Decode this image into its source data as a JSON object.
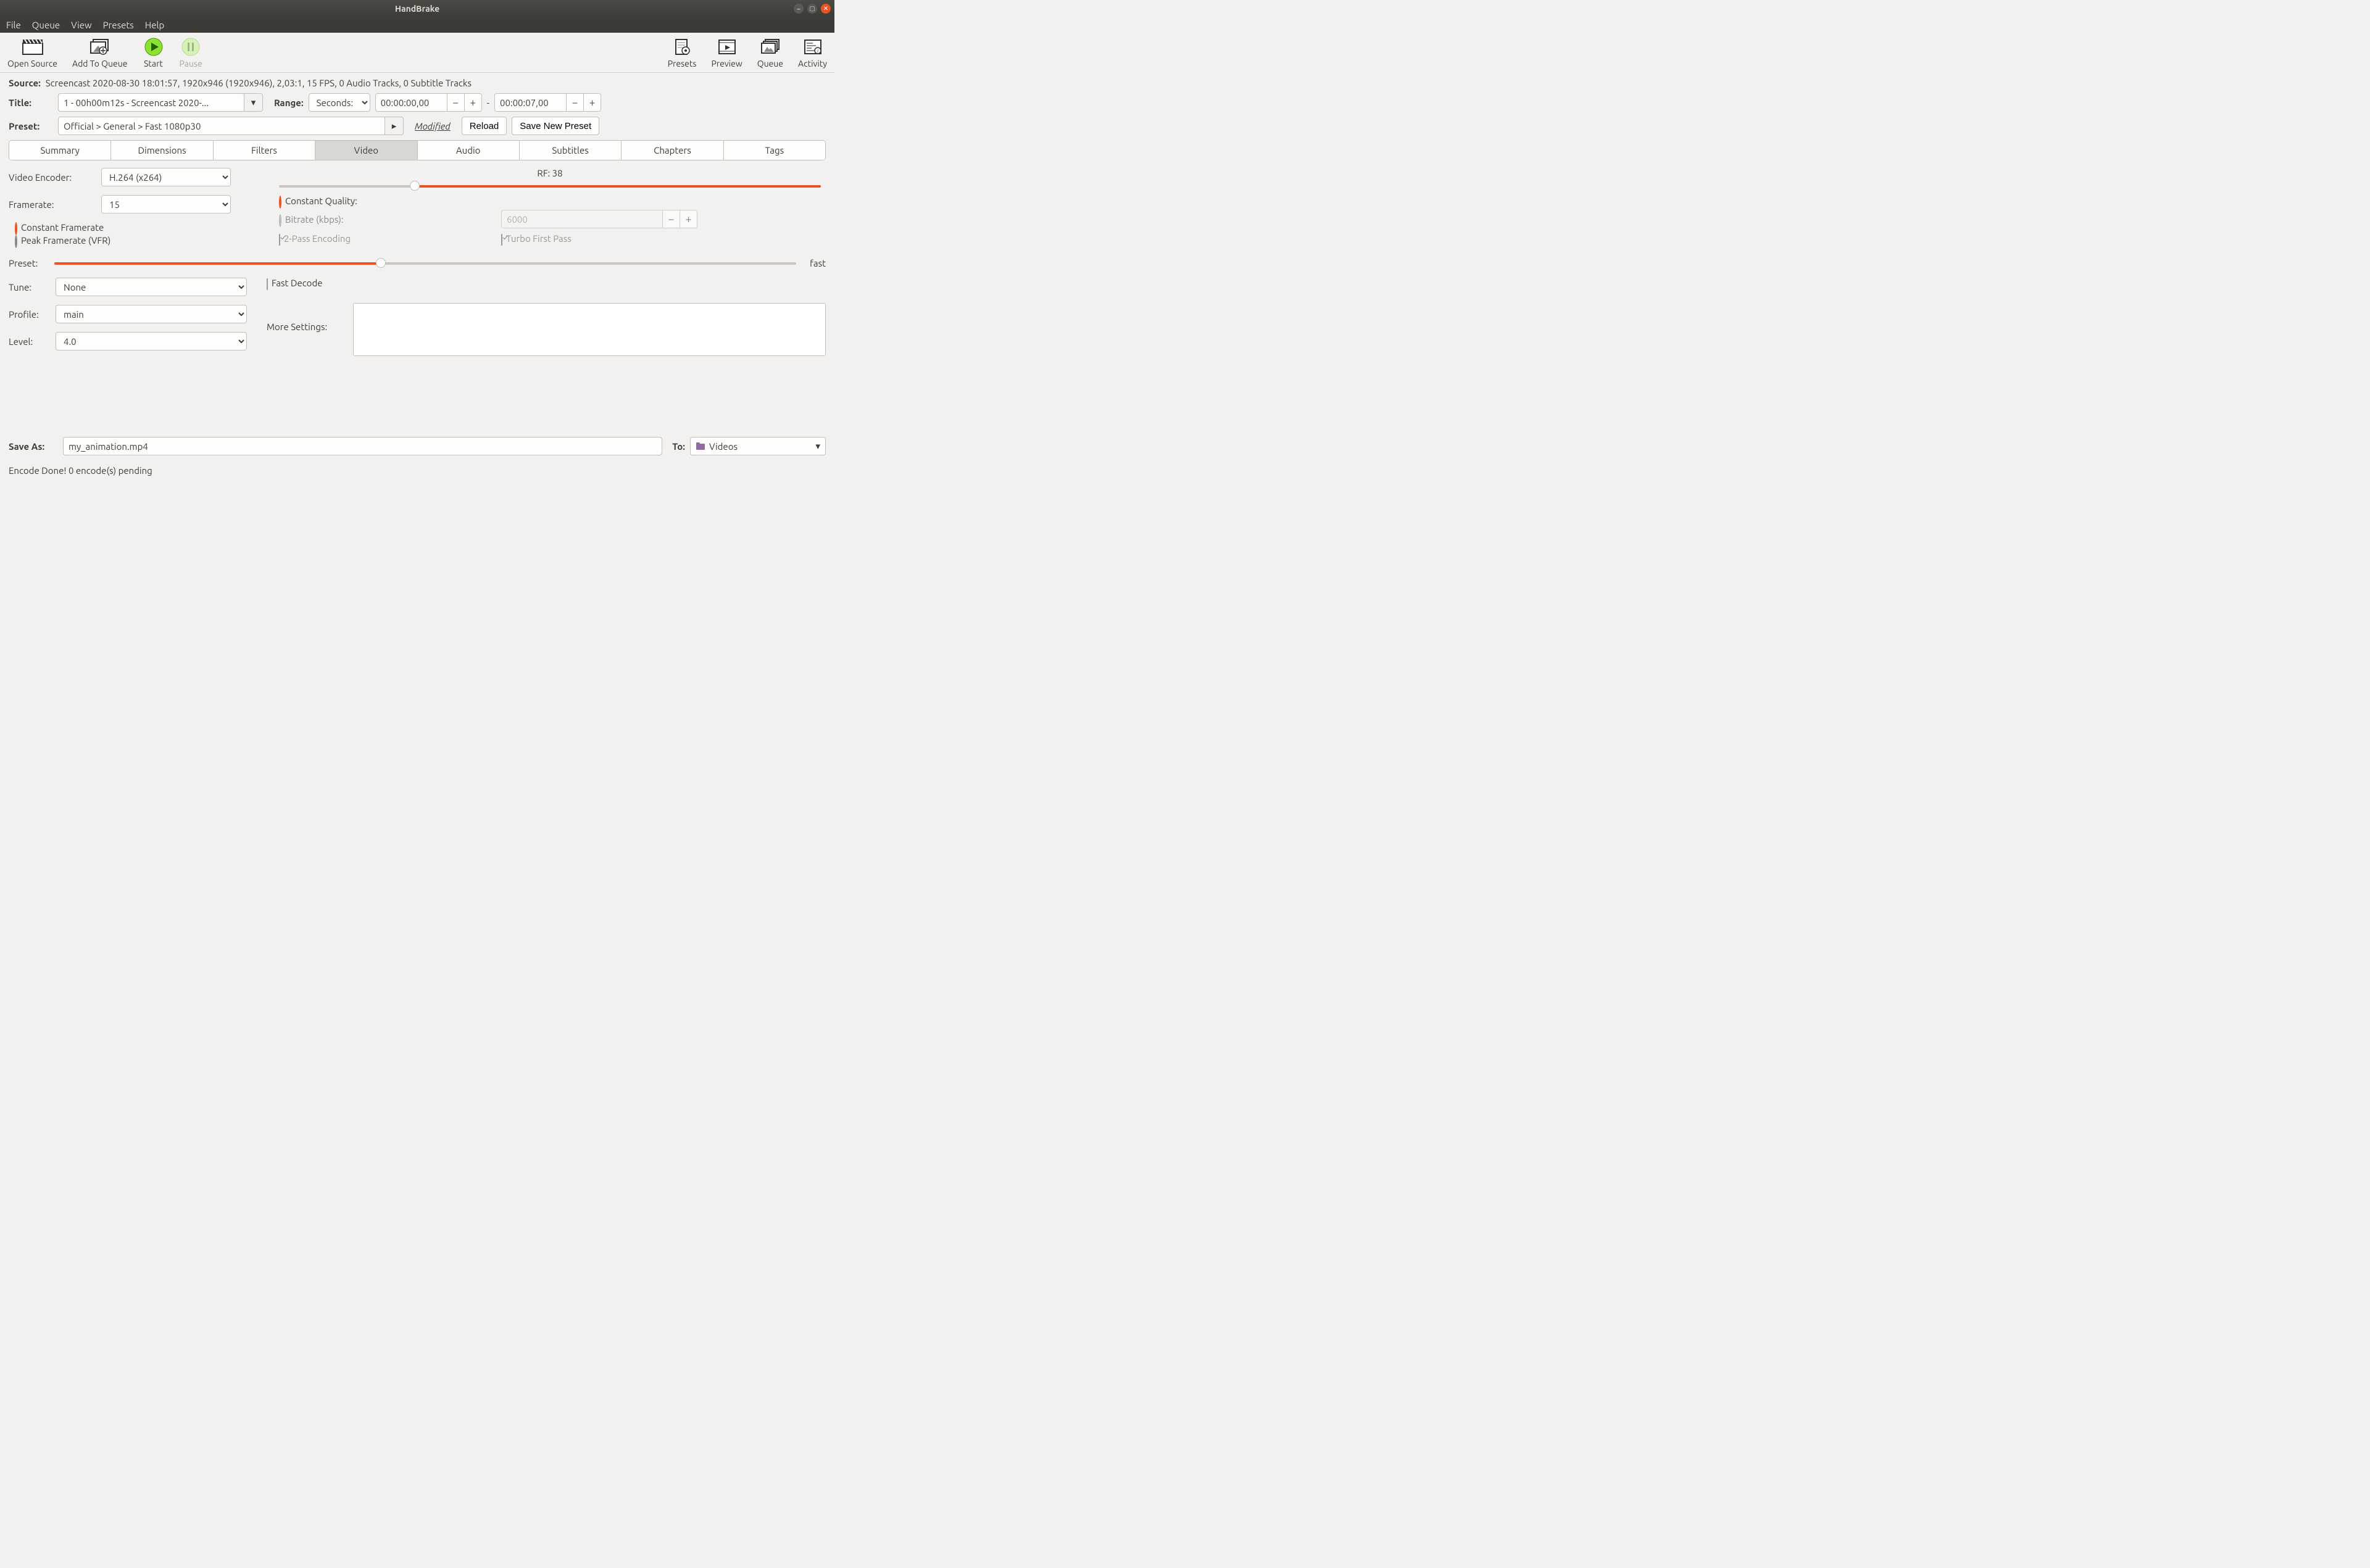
{
  "window": {
    "title": "HandBrake"
  },
  "menubar": [
    "File",
    "Queue",
    "View",
    "Presets",
    "Help"
  ],
  "toolbar": {
    "open_source": "Open Source",
    "add_to_queue": "Add To Queue",
    "start": "Start",
    "pause": "Pause",
    "presets": "Presets",
    "preview": "Preview",
    "queue": "Queue",
    "activity": "Activity"
  },
  "source": {
    "label": "Source:",
    "text": "Screencast 2020-08-30 18:01:57, 1920x946 (1920x946), 2,03:1, 15 FPS, 0 Audio Tracks, 0 Subtitle Tracks"
  },
  "title": {
    "label": "Title:",
    "value": "1 - 00h00m12s - Screencast 2020-..."
  },
  "range": {
    "label": "Range:",
    "mode": "Seconds:",
    "start": "00:00:00,00",
    "end": "00:00:07,00",
    "sep": "-"
  },
  "preset": {
    "label": "Preset:",
    "value": "Official > General > Fast 1080p30",
    "modified": "Modified",
    "reload": "Reload",
    "save_new": "Save New Preset"
  },
  "tabs": [
    "Summary",
    "Dimensions",
    "Filters",
    "Video",
    "Audio",
    "Subtitles",
    "Chapters",
    "Tags"
  ],
  "video": {
    "encoder_label": "Video Encoder:",
    "encoder_value": "H.264 (x264)",
    "framerate_label": "Framerate:",
    "framerate_value": "15",
    "cfr": "Constant Framerate",
    "pfr": "Peak Framerate (VFR)",
    "preset_label": "Preset:",
    "preset_speed": "fast",
    "tune_label": "Tune:",
    "tune_value": "None",
    "fast_decode": "Fast Decode",
    "profile_label": "Profile:",
    "profile_value": "main",
    "level_label": "Level:",
    "level_value": "4.0",
    "more_settings": "More Settings:",
    "rf_label": "RF: 38",
    "cq": "Constant Quality:",
    "bitrate": "Bitrate (kbps):",
    "bitrate_value": "6000",
    "two_pass": "2-Pass Encoding",
    "turbo": "Turbo First Pass"
  },
  "save": {
    "label": "Save As:",
    "filename": "my_animation.mp4",
    "to_label": "To:",
    "to_folder": "Videos"
  },
  "status": "Encode Done! 0 encode(s) pending"
}
